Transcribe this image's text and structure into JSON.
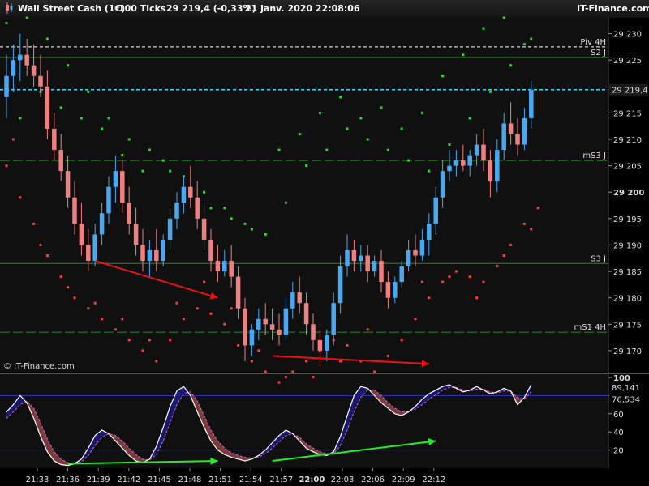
{
  "header": {
    "instrument": "Wall Street Cash (1€)",
    "timeframe": "100 Ticks",
    "quote": "29 219,4 (-0,33%)",
    "datetime": "21 janv. 2020 22:08:06",
    "brand": "IT-Finance.com"
  },
  "watermark": "© IT-Finance.com",
  "colors": {
    "bull": "#4aa8f0",
    "bear": "#f08080",
    "support_dots": "#ff3b3b",
    "resist_dots": "#22dd22",
    "pivot_line": "#ffffff",
    "level_line": "#228822",
    "price_line": "#33ddff",
    "osc_line1": "#ffffff",
    "osc_line2": "#cc66cc",
    "arrow_red": "#ee1111",
    "arrow_green": "#22ee22"
  },
  "chart_data": [
    {
      "type": "candlestick",
      "title": "Wall Street Cash (1€) 100 Ticks",
      "x_ticks": [
        "21:33",
        "21:36",
        "21:39",
        "21:42",
        "21:45",
        "21:48",
        "21:51",
        "21:54",
        "21:57",
        "22:00",
        "22:03",
        "22:06",
        "22:09",
        "22:12"
      ],
      "y_ticks": [
        "29 230",
        "29 225",
        "29 215",
        "29 210",
        "29 205",
        "29 200",
        "29 195",
        "29 190",
        "29 185",
        "29 180",
        "29 175",
        "29 170"
      ],
      "ylim": [
        29166,
        29233
      ],
      "levels": [
        {
          "name": "Piv 4H",
          "value": 29227.5,
          "style": "dashed-white"
        },
        {
          "name": "S2 J",
          "value": 29225.5,
          "style": "solid-green"
        },
        {
          "name": "mS3 J",
          "value": 29206,
          "style": "dashed-green"
        },
        {
          "name": "S3 J",
          "value": 29186.5,
          "style": "solid-green"
        },
        {
          "name": "mS1 4H",
          "value": 29173.5,
          "style": "dashed-green"
        }
      ],
      "current_price": {
        "label": "29 219,4",
        "value": 29219.4
      },
      "candles": [
        [
          29218,
          29226,
          29214,
          29222
        ],
        [
          29222,
          29228,
          29219,
          29225
        ],
        [
          29225,
          29230,
          29221,
          29226
        ],
        [
          29226,
          29229,
          29222,
          29224
        ],
        [
          29224,
          29228,
          29220,
          29222
        ],
        [
          29222,
          29226,
          29218,
          29220
        ],
        [
          29220,
          29223,
          29210,
          29212
        ],
        [
          29212,
          29215,
          29206,
          29208
        ],
        [
          29208,
          29211,
          29202,
          29204
        ],
        [
          29204,
          29207,
          29197,
          29199
        ],
        [
          29199,
          29202,
          29192,
          29194
        ],
        [
          29194,
          29198,
          29188,
          29190
        ],
        [
          29190,
          29193,
          29185,
          29187
        ],
        [
          29187,
          29194,
          29186,
          29192
        ],
        [
          29192,
          29198,
          29190,
          29196
        ],
        [
          29196,
          29203,
          29194,
          29201
        ],
        [
          29201,
          29207,
          29198,
          29204
        ],
        [
          29204,
          29206,
          29196,
          29198
        ],
        [
          29198,
          29201,
          29192,
          29194
        ],
        [
          29194,
          29197,
          29188,
          29190
        ],
        [
          29190,
          29193,
          29185,
          29187
        ],
        [
          29187,
          29191,
          29184,
          29189
        ],
        [
          29189,
          29193,
          29185,
          29187
        ],
        [
          29187,
          29192,
          29186,
          29191
        ],
        [
          29191,
          29197,
          29189,
          29195
        ],
        [
          29195,
          29200,
          29193,
          29198
        ],
        [
          29198,
          29203,
          29196,
          29201
        ],
        [
          29201,
          29205,
          29197,
          29199
        ],
        [
          29199,
          29202,
          29193,
          29195
        ],
        [
          29195,
          29198,
          29189,
          29191
        ],
        [
          29191,
          29193,
          29185,
          29187
        ],
        [
          29187,
          29190,
          29183,
          29185
        ],
        [
          29185,
          29189,
          29184,
          29187
        ],
        [
          29187,
          29190,
          29182,
          29184
        ],
        [
          29184,
          29186,
          29176,
          29178
        ],
        [
          29178,
          29180,
          29168,
          29171
        ],
        [
          29171,
          29175,
          29169,
          29174
        ],
        [
          29174,
          29178,
          29172,
          29176
        ],
        [
          29176,
          29179,
          29173,
          29175
        ],
        [
          29175,
          29178,
          29172,
          29174
        ],
        [
          29174,
          29177,
          29171,
          29173
        ],
        [
          29173,
          29180,
          29172,
          29178
        ],
        [
          29178,
          29183,
          29176,
          29181
        ],
        [
          29181,
          29184,
          29177,
          29179
        ],
        [
          29179,
          29181,
          29173,
          29175
        ],
        [
          29175,
          29177,
          29170,
          29172
        ],
        [
          29172,
          29174,
          29167,
          29170
        ],
        [
          29170,
          29174,
          29168,
          29173
        ],
        [
          29173,
          29181,
          29171,
          29179
        ],
        [
          29179,
          29188,
          29177,
          29186
        ],
        [
          29186,
          29192,
          29184,
          29189
        ],
        [
          29189,
          29191,
          29185,
          29187
        ],
        [
          29187,
          29190,
          29185,
          29188
        ],
        [
          29188,
          29190,
          29183,
          29185
        ],
        [
          29185,
          29188,
          29184,
          29187
        ],
        [
          29187,
          29189,
          29181,
          29183
        ],
        [
          29183,
          29185,
          29178,
          29180
        ],
        [
          29180,
          29184,
          29179,
          29183
        ],
        [
          29183,
          29187,
          29182,
          29186
        ],
        [
          29186,
          29191,
          29185,
          29189
        ],
        [
          29189,
          29192,
          29186,
          29188
        ],
        [
          29188,
          29193,
          29187,
          29191
        ],
        [
          29191,
          29196,
          29188,
          29194
        ],
        [
          29194,
          29201,
          29192,
          29199
        ],
        [
          29199,
          29206,
          29197,
          29204
        ],
        [
          29204,
          29208,
          29202,
          29205
        ],
        [
          29205,
          29208,
          29203,
          29206
        ],
        [
          29206,
          29209,
          29204,
          29205
        ],
        [
          29205,
          29208,
          29203,
          29207
        ],
        [
          29207,
          29211,
          29205,
          29209
        ],
        [
          29209,
          29212,
          29204,
          29206
        ],
        [
          29206,
          29208,
          29199,
          29202
        ],
        [
          29202,
          29210,
          29200,
          29208
        ],
        [
          29208,
          29215,
          29206,
          29213
        ],
        [
          29213,
          29217,
          29209,
          29211
        ],
        [
          29211,
          29214,
          29207,
          29209
        ],
        [
          29209,
          29216,
          29208,
          29214
        ],
        [
          29214,
          29221,
          29212,
          29219.4
        ]
      ],
      "resistance_dots": [
        [
          0,
          29232
        ],
        [
          3,
          29233
        ],
        [
          6,
          29229
        ],
        [
          9,
          29224
        ],
        [
          12,
          29219
        ],
        [
          15,
          29214
        ],
        [
          18,
          29210
        ],
        [
          21,
          29208
        ],
        [
          24,
          29204
        ],
        [
          27,
          29200
        ],
        [
          30,
          29197
        ],
        [
          33,
          29195
        ],
        [
          36,
          29193
        ],
        [
          2,
          29214
        ],
        [
          5,
          29219
        ],
        [
          8,
          29216
        ],
        [
          11,
          29214
        ],
        [
          14,
          29212
        ],
        [
          17,
          29207
        ],
        [
          20,
          29204
        ],
        [
          23,
          29206
        ],
        [
          26,
          29203
        ],
        [
          29,
          29200
        ],
        [
          32,
          29197
        ],
        [
          35,
          29194
        ],
        [
          38,
          29192
        ],
        [
          41,
          29198
        ],
        [
          44,
          29205
        ],
        [
          47,
          29208
        ],
        [
          50,
          29212
        ],
        [
          53,
          29210
        ],
        [
          56,
          29208
        ],
        [
          59,
          29206
        ],
        [
          62,
          29204
        ],
        [
          65,
          29209
        ],
        [
          68,
          29214
        ],
        [
          71,
          29219
        ],
        [
          74,
          29224
        ],
        [
          77,
          29229
        ],
        [
          40,
          29208
        ],
        [
          43,
          29211
        ],
        [
          46,
          29215
        ],
        [
          49,
          29218
        ],
        [
          52,
          29214
        ],
        [
          55,
          29216
        ],
        [
          58,
          29212
        ],
        [
          61,
          29215
        ],
        [
          64,
          29222
        ],
        [
          67,
          29226
        ],
        [
          70,
          29231
        ],
        [
          73,
          29233
        ],
        [
          76,
          29228
        ]
      ],
      "support_dots": [
        [
          0,
          29205
        ],
        [
          2,
          29199
        ],
        [
          4,
          29194
        ],
        [
          6,
          29188
        ],
        [
          8,
          29184
        ],
        [
          10,
          29180
        ],
        [
          12,
          29178
        ],
        [
          14,
          29176
        ],
        [
          16,
          29174
        ],
        [
          18,
          29172
        ],
        [
          20,
          29170
        ],
        [
          22,
          29168
        ],
        [
          24,
          29172
        ],
        [
          26,
          29176
        ],
        [
          28,
          29178
        ],
        [
          30,
          29177
        ],
        [
          32,
          29175
        ],
        [
          34,
          29171
        ],
        [
          36,
          29168
        ],
        [
          38,
          29166
        ],
        [
          40,
          29164
        ],
        [
          42,
          29166
        ],
        [
          44,
          29168
        ],
        [
          46,
          29170
        ],
        [
          48,
          29172
        ],
        [
          50,
          29171
        ],
        [
          52,
          29168
        ],
        [
          54,
          29166
        ],
        [
          56,
          29169
        ],
        [
          58,
          29172
        ],
        [
          60,
          29176
        ],
        [
          62,
          29180
        ],
        [
          64,
          29183
        ],
        [
          66,
          29185
        ],
        [
          68,
          29184
        ],
        [
          70,
          29183
        ],
        [
          72,
          29186
        ],
        [
          74,
          29190
        ],
        [
          76,
          29194
        ],
        [
          78,
          29197
        ],
        [
          1,
          29210
        ],
        [
          5,
          29190
        ],
        [
          9,
          29182
        ],
        [
          13,
          29179
        ],
        [
          17,
          29176
        ],
        [
          21,
          29172
        ],
        [
          25,
          29179
        ],
        [
          29,
          29183
        ],
        [
          33,
          29178
        ],
        [
          37,
          29170
        ],
        [
          41,
          29165
        ],
        [
          45,
          29165
        ],
        [
          49,
          29168
        ],
        [
          53,
          29174
        ],
        [
          57,
          29181
        ],
        [
          61,
          29183
        ],
        [
          65,
          29184
        ],
        [
          69,
          29180
        ],
        [
          73,
          29188
        ],
        [
          77,
          29193
        ]
      ],
      "arrows": [
        {
          "color": "red",
          "from": [
            13,
            29187
          ],
          "to": [
            31,
            29180
          ]
        },
        {
          "color": "red",
          "from": [
            39,
            29169
          ],
          "to": [
            62,
            29167.5
          ]
        }
      ]
    },
    {
      "type": "line",
      "ylim": [
        0,
        100
      ],
      "y_ticks": [
        "100",
        "80",
        "60",
        "40",
        "20"
      ],
      "reference_lines": [
        80,
        20
      ],
      "value_labels": [
        "89,141",
        "76,534"
      ],
      "series": [
        {
          "values": [
            62,
            70,
            80,
            72,
            55,
            35,
            18,
            8,
            4,
            3,
            5,
            10,
            22,
            36,
            42,
            38,
            30,
            22,
            14,
            8,
            6,
            10,
            24,
            45,
            68,
            85,
            90,
            80,
            62,
            45,
            30,
            20,
            15,
            12,
            10,
            8,
            10,
            14,
            20,
            28,
            36,
            42,
            38,
            30,
            22,
            18,
            15,
            14,
            18,
            35,
            58,
            80,
            90,
            88,
            80,
            72,
            66,
            60,
            58,
            62,
            68,
            76,
            82,
            86,
            90,
            92,
            88,
            84,
            86,
            90,
            86,
            82,
            84,
            88,
            85,
            70,
            78,
            92
          ]
        },
        {
          "values": [
            55,
            62,
            70,
            74,
            66,
            50,
            32,
            18,
            10,
            6,
            5,
            7,
            14,
            25,
            34,
            38,
            36,
            30,
            22,
            15,
            10,
            9,
            15,
            30,
            50,
            70,
            82,
            84,
            74,
            58,
            42,
            30,
            22,
            17,
            14,
            12,
            11,
            12,
            16,
            22,
            29,
            36,
            38,
            34,
            27,
            22,
            18,
            16,
            16,
            25,
            42,
            62,
            78,
            86,
            86,
            80,
            72,
            66,
            62,
            62,
            65,
            70,
            76,
            81,
            86,
            89,
            89,
            86,
            85,
            87,
            87,
            84,
            83,
            85,
            85,
            78,
            76,
            84
          ]
        }
      ],
      "arrows": [
        {
          "color": "green",
          "from": [
            9,
            5
          ],
          "to": [
            31,
            8
          ]
        },
        {
          "color": "green",
          "from": [
            39,
            8
          ],
          "to": [
            63,
            30
          ]
        }
      ]
    }
  ]
}
